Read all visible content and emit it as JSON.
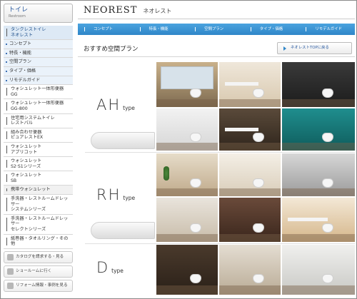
{
  "sidebar": {
    "header_title": "トイレ",
    "header_sub": "Restroom",
    "items": [
      {
        "label": "タンクレストイレ\nネオレスト",
        "style": "active"
      },
      {
        "label": "コンセプト",
        "style": "bullet"
      },
      {
        "label": "特長・機能",
        "style": "bullet"
      },
      {
        "label": "空間プラン",
        "style": "bullet"
      },
      {
        "label": "タイプ・価格",
        "style": "bullet"
      },
      {
        "label": "リモデルガイド",
        "style": "bullet"
      },
      {
        "label": "ウォシュレット一体形便器\nGG",
        "style": "normal"
      },
      {
        "label": "ウォシュレット一体形便器\nGG-800",
        "style": "normal"
      },
      {
        "label": "住宅用システムトイレ\nレストパル",
        "style": "normal"
      },
      {
        "label": "組み合わせ便器\nピュアレストEX",
        "style": "normal"
      },
      {
        "label": "ウォシュレット\nアプリコット",
        "style": "normal"
      },
      {
        "label": "ウォシュレット\nS2·S1シリーズ",
        "style": "normal"
      },
      {
        "label": "ウォシュレット\nSB",
        "style": "normal"
      },
      {
        "label": "携帯ウォシュレット",
        "style": "normal"
      },
      {
        "label": "手洗器・レストルームドレッサー\nシステムシリーズ",
        "style": "normal"
      },
      {
        "label": "手洗器・レストルームドレッサー\nセレクトシリーズ",
        "style": "normal"
      },
      {
        "label": "紙巻器・タオルリング・その他",
        "style": "normal"
      }
    ],
    "buttons": [
      {
        "label": "カタログを請求する・見る"
      },
      {
        "label": "ショールームに行く"
      },
      {
        "label": "リフォーム情報・事例を見る"
      }
    ]
  },
  "header": {
    "brand": "NEOREST",
    "brand_kana": "ネオレスト"
  },
  "nav": {
    "items": [
      "コンセプト",
      "特長・機能",
      "空間プラン",
      "タイプ・価格",
      "リモデルガイド"
    ]
  },
  "main": {
    "title": "おすすめ空間プラン",
    "top_button": "ネオレストTOPに戻る",
    "types": [
      {
        "big": "AH",
        "small": "type"
      },
      {
        "big": "RH",
        "small": "type"
      },
      {
        "big": "D",
        "small": "type"
      }
    ]
  },
  "colors": {
    "nav_blue": "#2f86c8",
    "active_bg": "#dde9f5"
  }
}
